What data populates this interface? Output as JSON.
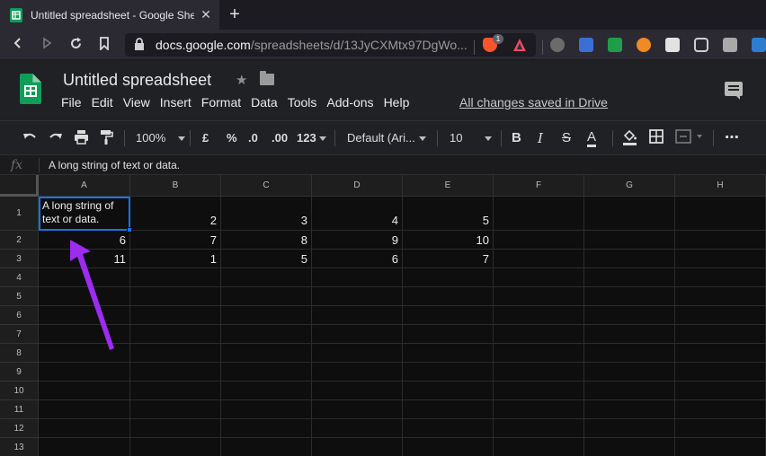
{
  "browser": {
    "tab_title": "Untitled spreadsheet - Google She",
    "tab_close": "✕",
    "new_tab": "+",
    "url_host": "docs.google.com",
    "url_path": "/spreadsheets/d/13JyCXMtx97DgWo...",
    "brave_badge": "1"
  },
  "header": {
    "doc_title": "Untitled spreadsheet",
    "star": "★",
    "menu": [
      "File",
      "Edit",
      "View",
      "Insert",
      "Format",
      "Data",
      "Tools",
      "Add-ons",
      "Help"
    ],
    "saved_status": "All changes saved in Drive"
  },
  "toolbar": {
    "zoom": "100%",
    "currency": "£",
    "percent": "%",
    "decrease_decimals": ".0",
    "increase_decimals": ".00",
    "more_formats": "123",
    "font": "Default (Ari...",
    "font_size": "10",
    "bold": "B",
    "italic": "I",
    "strike": "S",
    "text_color": "A",
    "more": "⋯"
  },
  "formula_bar": {
    "fx": "fx",
    "content": "A long string of text or data."
  },
  "grid": {
    "columns": [
      "A",
      "B",
      "C",
      "D",
      "E",
      "F",
      "G",
      "H"
    ],
    "rows": [
      "1",
      "2",
      "3",
      "4",
      "5",
      "6",
      "7",
      "8",
      "9",
      "10",
      "11",
      "12",
      "13"
    ],
    "cells": [
      [
        "A long string of text or data.",
        "2",
        "3",
        "4",
        "5",
        "",
        "",
        ""
      ],
      [
        "6",
        "7",
        "8",
        "9",
        "10",
        "",
        "",
        ""
      ],
      [
        "11",
        "1",
        "5",
        "6",
        "7",
        "",
        "",
        ""
      ]
    ],
    "selected": "A1"
  },
  "colors": {
    "accent": "#1a73e8",
    "sheets_green": "#0f9d58",
    "annotation_arrow": "#9b2cf0"
  }
}
